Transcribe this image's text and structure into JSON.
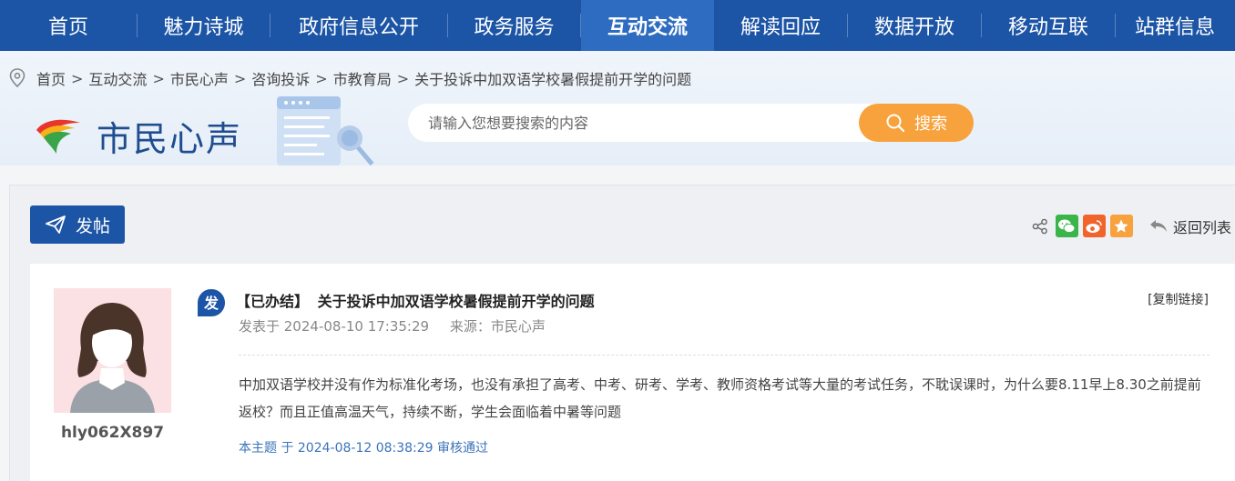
{
  "nav": {
    "items": [
      {
        "label": "首页"
      },
      {
        "label": "魅力诗城"
      },
      {
        "label": "政府信息公开"
      },
      {
        "label": "政务服务"
      },
      {
        "label": "互动交流",
        "active": true
      },
      {
        "label": "解读回应"
      },
      {
        "label": "数据开放"
      },
      {
        "label": "移动互联"
      },
      {
        "label": "站群信息"
      }
    ]
  },
  "breadcrumb": {
    "items": [
      "首页",
      "互动交流",
      "市民心声",
      "咨询投诉",
      "市教育局",
      "关于投诉中加双语学校暑假提前开学的问题"
    ],
    "separator": ">"
  },
  "logo": {
    "text": "市民心声"
  },
  "search": {
    "placeholder": "请输入您想要搜索的内容",
    "button_label": "搜索"
  },
  "toolbar": {
    "post_label": "发帖",
    "back_label": "返回列表",
    "share_icons": [
      "share-icon",
      "wechat-icon",
      "weibo-icon",
      "favorite-icon"
    ]
  },
  "post": {
    "author": "hly062X897",
    "badge": "发",
    "status": "【已办结】",
    "title": "关于投诉中加双语学校暑假提前开学的问题",
    "copy_link": "[复制链接]",
    "posted_at": "发表于 2024-08-10 17:35:29",
    "source": "来源：市民心声",
    "body": "中加双语学校并没有作为标准化考场，也没有承担了高考、中考、研考、学考、教师资格考试等大量的考试任务，不耽误课时，为什么要8.11早上8.30之前提前返校？而且正值高温天气，持续不断，学生会面临着中暑等问题",
    "audit": "本主题 于 2024-08-12 08:38:29 审核通过"
  },
  "colors": {
    "nav_bg": "#1c55a6",
    "nav_active": "#2d6cc0",
    "search_button": "#f7a23d",
    "link_blue": "#3b73b9"
  }
}
